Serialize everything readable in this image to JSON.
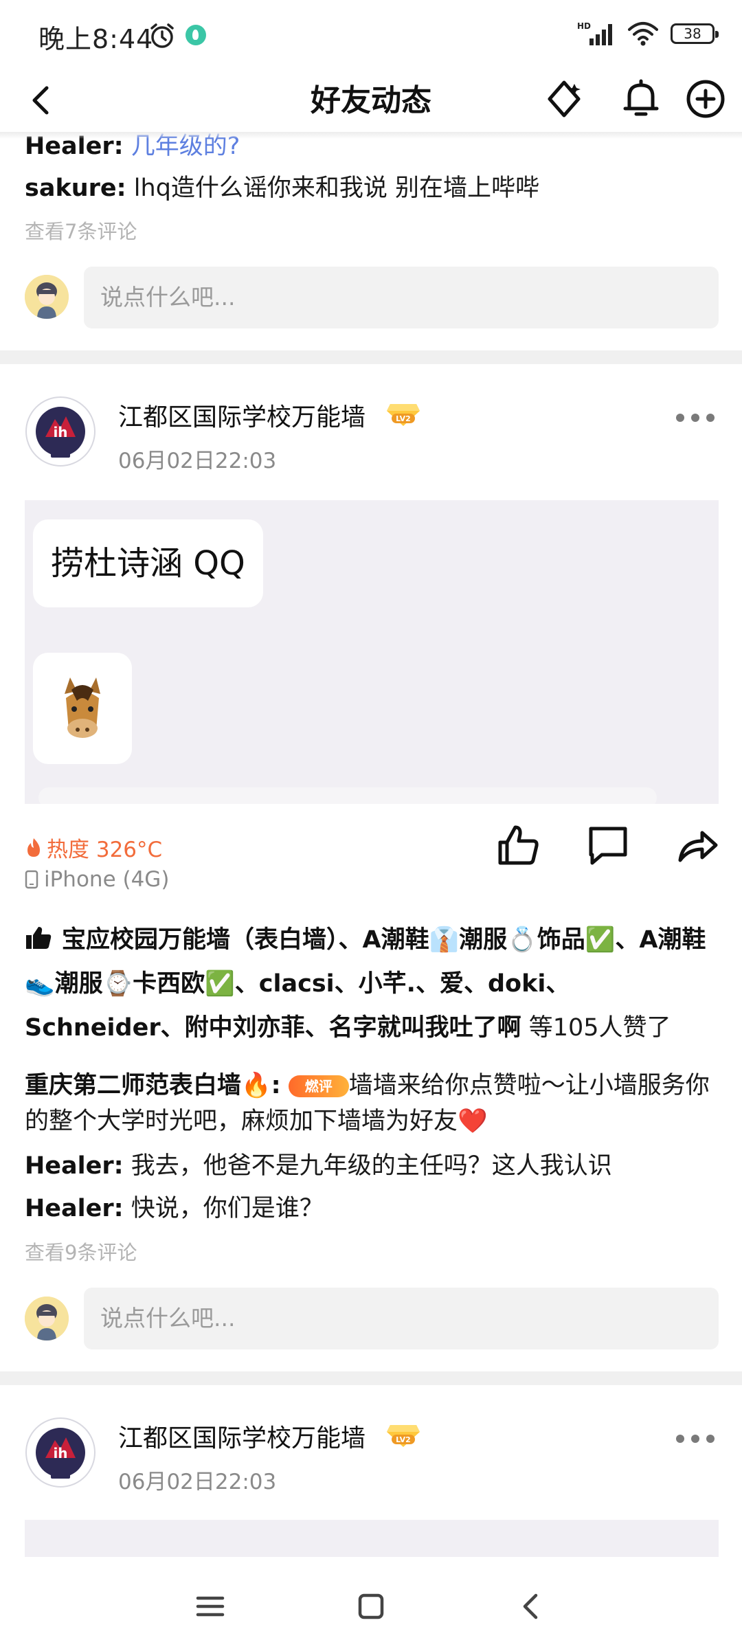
{
  "status_bar": {
    "time": "晚上8:44",
    "battery": "38",
    "network": "HD"
  },
  "nav": {
    "title": "好友动态"
  },
  "prev_post": {
    "comments": [
      {
        "name": "Healer:",
        "text": "几年级的?"
      },
      {
        "name": "sakure:",
        "text": "lhq造什么谣你来和我说 别在墙上哔哔"
      }
    ],
    "view_all": "查看7条评论",
    "input_placeholder": "说点什么吧..."
  },
  "post1": {
    "poster": "江都区国际学校万能墙",
    "level": "LV2",
    "time": "06月02日22:03",
    "image": {
      "bubble_text": "捞杜诗涵 QQ",
      "emoji": "🐴"
    },
    "heat": "热度 326°C",
    "device": "iPhone (4G)",
    "likes": {
      "names": "宝应校园万能墙（表白墙）、A潮鞋👔潮服💍饰品✅、A潮鞋👟潮服⌚卡西欧✅、clacsi、小芊.、爱、doki、Schneider、附中刘亦菲、名字就叫我吐了啊",
      "suffix": " 等105人赞了"
    },
    "comments": [
      {
        "name": "重庆第二师范表白墙🔥:",
        "tag": "燃评",
        "text": "墙墙来给你点赞啦～让小墙服务你的整个大学时光吧，麻烦加下墙墙为好友❤️"
      },
      {
        "name": "Healer:",
        "text": " 我去，他爸不是九年级的主任吗？这人我认识"
      },
      {
        "name": "Healer:",
        "text": " 快说，你们是谁？"
      }
    ],
    "view_all": "查看9条评论",
    "input_placeholder": "说点什么吧..."
  },
  "post2": {
    "poster": "江都区国际学校万能墙",
    "level": "LV2",
    "time": "06月02日22:03"
  },
  "colors": {
    "heat": "#f26c3b",
    "link": "#5d7fe0",
    "divider": "#f0f0f0"
  }
}
